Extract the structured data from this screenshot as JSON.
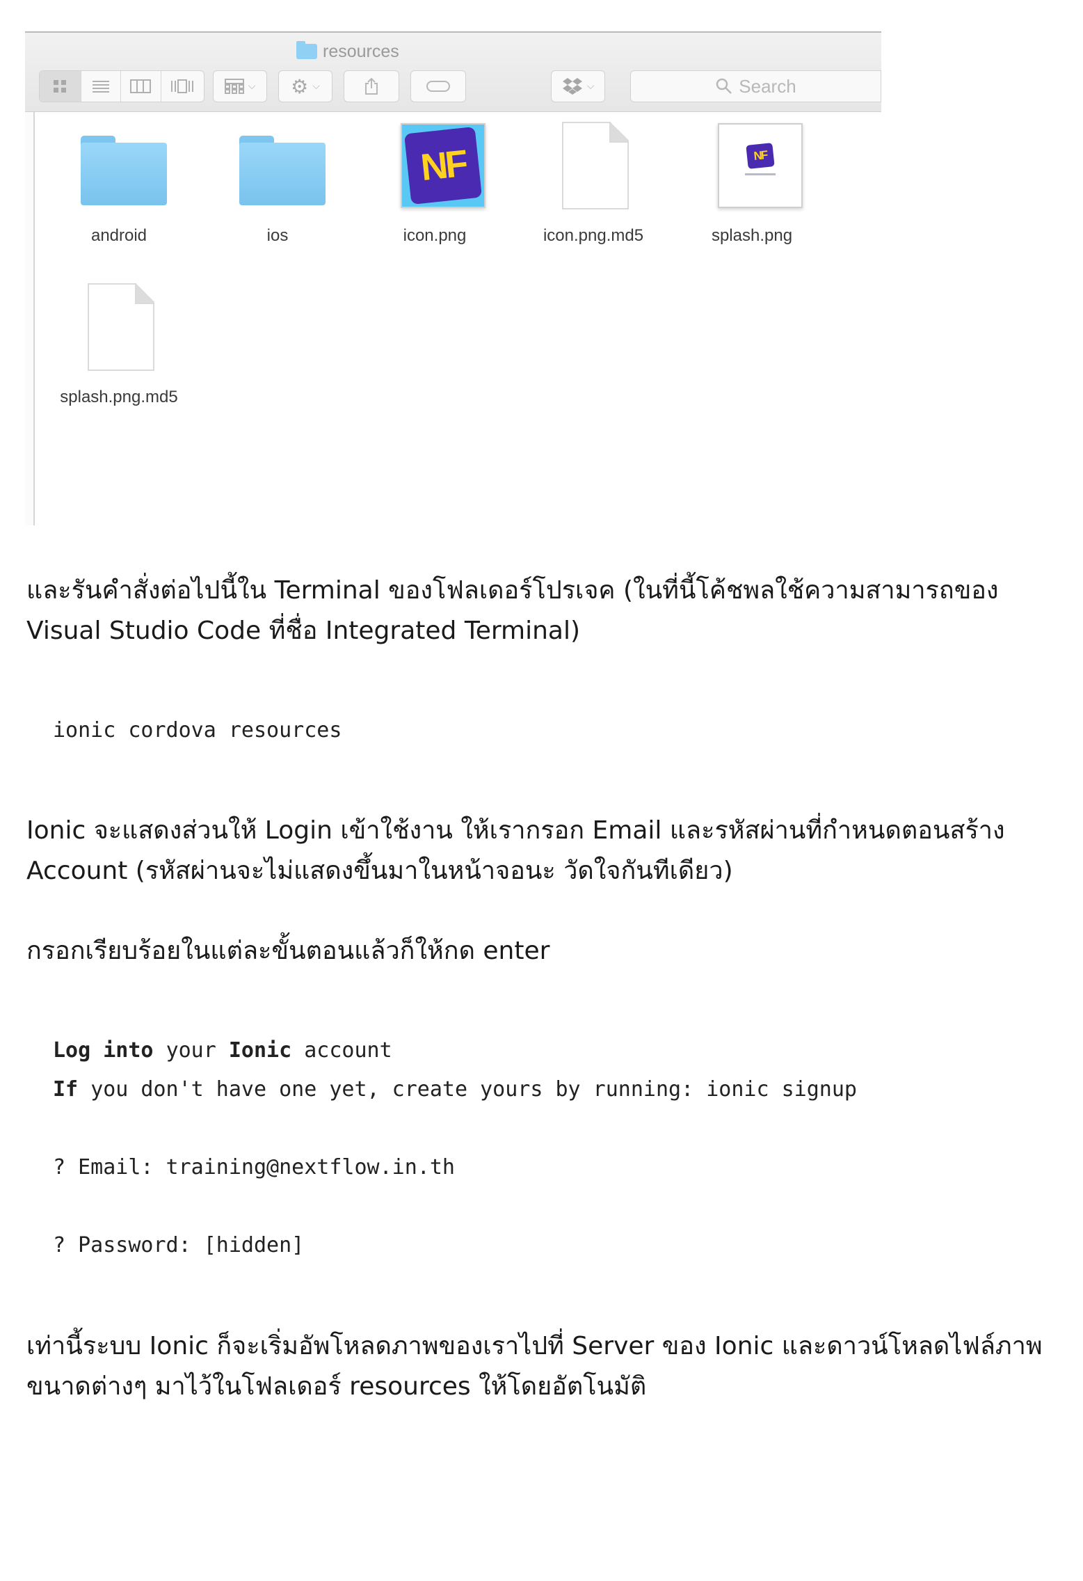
{
  "finder": {
    "title": "resources",
    "search_placeholder": "Search",
    "files": [
      {
        "name": "android",
        "kind": "folder"
      },
      {
        "name": "ios",
        "kind": "folder"
      },
      {
        "name": "icon.png",
        "kind": "image"
      },
      {
        "name": "icon.png.md5",
        "kind": "document"
      },
      {
        "name": "splash.png",
        "kind": "image"
      },
      {
        "name": "splash.png.md5",
        "kind": "document"
      }
    ]
  },
  "text": {
    "para1": "และรันคำสั่งต่อไปนี้ใน Terminal ของโฟลเดอร์โปรเจค (ในที่นี้โค้ชพลใช้ความสามารถของ Visual Studio Code ที่ชื่อ Integrated Terminal)",
    "command": "ionic cordova resources",
    "para2": "Ionic จะแสดงส่วนให้ Login เข้าใช้งาน ให้เรากรอก Email และรหัสผ่านที่กำหนดตอนสร้าง Account (รหัสผ่านจะไม่แสดงขึ้นมาในหน้าจอนะ วัดใจกันทีเดียว)",
    "para3": "กรอกเรียบร้อยในแต่ละขั้นตอนแล้วก็ให้กด enter",
    "login": {
      "line1": {
        "w1": "Log",
        "w2": "into",
        "w3": "your",
        "w4": "Ionic",
        "w5": "account"
      },
      "line2": {
        "w1": "If",
        "rest": "you don't have one yet, create yours by running: ionic signup"
      },
      "email": "? Email: training@nextflow.in.th",
      "password": "? Password: [hidden]"
    },
    "para4": "เท่านี้ระบบ Ionic ก็จะเริ่มอัพโหลดภาพของเราไปที่ Server ของ Ionic และดาวน์โหลดไฟล์ภาพ ขนาดต่างๆ มาไว้ในโฟลเดอร์  resources ให้โดยอัตโนมัติ"
  },
  "icons": {
    "folder": "folder-icon",
    "search": "search-icon",
    "gear": "gear-icon",
    "share": "share-icon",
    "tag": "tag-icon",
    "dropbox": "dropbox-icon"
  },
  "colors": {
    "folder_blue": "#7ec6ef",
    "nf_purple": "#4b2ab2",
    "nf_yellow": "#ffd21e",
    "icon_bg": "#5ac8f5"
  }
}
